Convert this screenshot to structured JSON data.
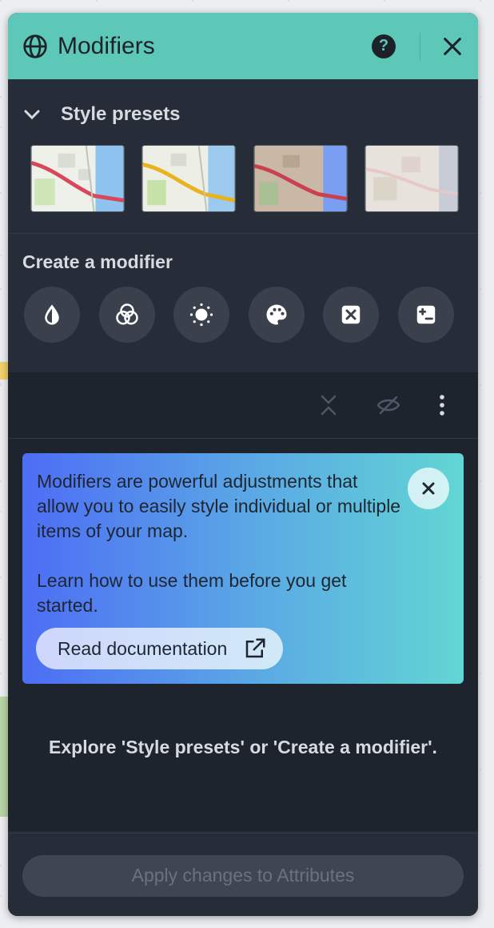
{
  "header": {
    "title": "Modifiers",
    "help_icon": "help-icon",
    "close_icon": "close-icon",
    "bg_color": "#5ec8b8"
  },
  "presets": {
    "label": "Style presets",
    "items": [
      {
        "name": "preset-1"
      },
      {
        "name": "preset-2"
      },
      {
        "name": "preset-3"
      },
      {
        "name": "preset-4"
      }
    ]
  },
  "create": {
    "label": "Create a modifier",
    "buttons": [
      {
        "icon": "drop-icon"
      },
      {
        "icon": "color-mix-icon"
      },
      {
        "icon": "brightness-icon"
      },
      {
        "icon": "palette-icon"
      },
      {
        "icon": "hide-icon"
      },
      {
        "icon": "plus-minus-icon"
      }
    ]
  },
  "toolbar": {
    "icons": [
      "collapse-icon",
      "visibility-off-icon",
      "more-icon"
    ]
  },
  "info": {
    "text1": "Modifiers are powerful adjustments that allow you to easily style individual or multiple items of your map.",
    "text2": "Learn how to use them before you get started.",
    "doc_label": "Read documentation",
    "gradient": [
      "#4d6df5",
      "#62d6d4"
    ]
  },
  "empty_message": "Explore 'Style presets' or 'Create a modifier'.",
  "footer": {
    "apply_label": "Apply changes to Attributes"
  }
}
